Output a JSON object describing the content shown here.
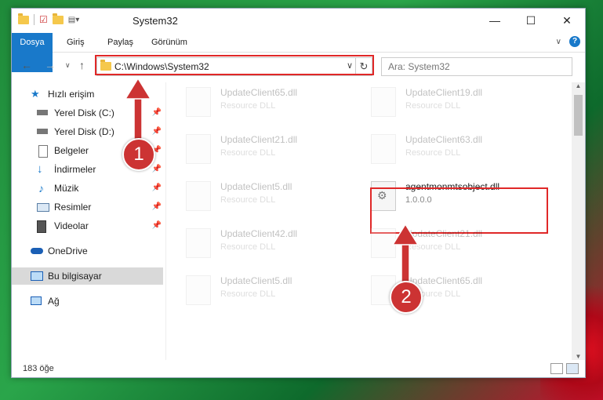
{
  "window": {
    "title": "System32"
  },
  "ribbon": {
    "tabs": [
      "Dosya",
      "Giriş",
      "Paylaş",
      "Görünüm"
    ]
  },
  "address": {
    "path": "C:\\Windows\\System32"
  },
  "search": {
    "placeholder": "Ara: System32"
  },
  "sidebar": {
    "items": [
      {
        "label": "Hızlı erişim",
        "icon": "star-icon"
      },
      {
        "label": "Yerel Disk (C:)",
        "icon": "drive-icon"
      },
      {
        "label": "Yerel Disk (D:)",
        "icon": "drive-icon"
      },
      {
        "label": "Belgeler",
        "icon": "document-icon"
      },
      {
        "label": "İndirmeler",
        "icon": "download-icon"
      },
      {
        "label": "Müzik",
        "icon": "music-icon"
      },
      {
        "label": "Resimler",
        "icon": "pictures-icon"
      },
      {
        "label": "Videolar",
        "icon": "video-icon"
      },
      {
        "label": "OneDrive",
        "icon": "cloud-icon"
      },
      {
        "label": "Bu bilgisayar",
        "icon": "computer-icon"
      },
      {
        "label": "Ağ",
        "icon": "network-icon"
      }
    ]
  },
  "files": [
    {
      "name": "UpdateClient65.dll",
      "desc": "Resource DLL"
    },
    {
      "name": "UpdateClient19.dll",
      "desc": "Resource DLL"
    },
    {
      "name": "UpdateClient21.dll",
      "desc": "Resource DLL"
    },
    {
      "name": "UpdateClient63.dll",
      "desc": "Resource DLL"
    },
    {
      "name": "UpdateClient5.dll",
      "desc": "Resource DLL"
    },
    {
      "name": "agentmonmtsobject.dll",
      "desc": "1.0.0.0"
    },
    {
      "name": "UpdateClient42.dll",
      "desc": "Resource DLL"
    },
    {
      "name": "UpdateClient21.dll",
      "desc": "Resource DLL"
    },
    {
      "name": "UpdateClient5.dll",
      "desc": "Resource DLL"
    },
    {
      "name": "UpdateClient65.dll",
      "desc": "Resource DLL"
    }
  ],
  "status": {
    "count": "183 öğe"
  },
  "callouts": [
    "1",
    "2"
  ],
  "colors": {
    "accent": "#1979ca",
    "highlight": "#e02828",
    "callout": "#cc3333"
  }
}
